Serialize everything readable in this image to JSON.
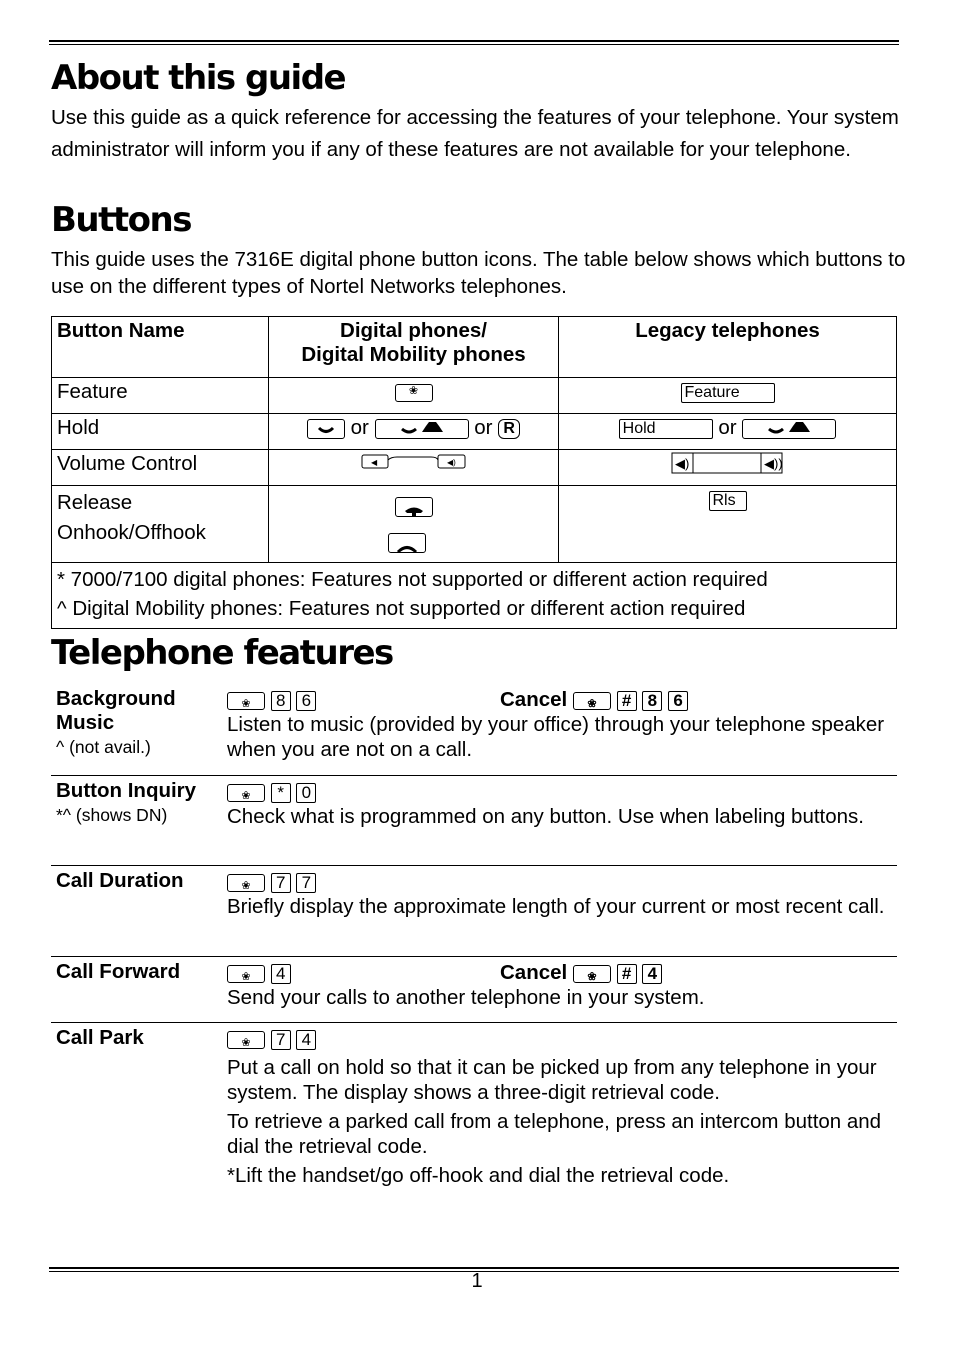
{
  "about": {
    "title": "About this guide",
    "body": "Use this guide as a quick reference for accessing the features of your telephone. Your system administrator will inform you if any of these features are not available for your telephone."
  },
  "buttons": {
    "title": "Buttons",
    "body": "This guide uses the 7316E digital phone button icons. The table below shows which buttons to use on the different types of Nortel Networks telephones.",
    "table": {
      "headers": [
        "Button Name",
        "Digital phones/",
        "Digital Mobility phones",
        "Legacy telephones"
      ],
      "rows": [
        {
          "name": "Feature",
          "digital": "feature-key-icon",
          "legacy": "Feature"
        },
        {
          "name": "Hold",
          "or": "or",
          "legacy": "Hold"
        },
        {
          "name": "Volume Control"
        },
        {
          "name": "Release",
          "name2": "Onhook/Offhook",
          "legacy": "Rls"
        }
      ],
      "r_key": "R",
      "notes": [
        "* 7000/7100 digital phones: Features not supported or different action required",
        "^ Digital Mobility phones: Features not supported or different action required"
      ]
    }
  },
  "features": {
    "title": "Telephone features",
    "cancel_label": "Cancel",
    "items": [
      {
        "name": "Background Music",
        "sub": "^ (not avail.)",
        "keys": [
          "8",
          "6"
        ],
        "cancel": [
          "#",
          "8",
          "6"
        ],
        "desc": [
          "Listen to music (provided by your office) through your telephone speaker when you are not on a call."
        ]
      },
      {
        "name": "Button Inquiry",
        "sub": "*^ (shows DN)",
        "keys": [
          "*",
          "0"
        ],
        "desc": [
          "Check what is programmed on any button. Use when labeling buttons."
        ]
      },
      {
        "name": "Call Duration",
        "keys": [
          "7",
          "7"
        ],
        "desc": [
          "Briefly display the approximate length of your current or most recent call."
        ]
      },
      {
        "name": "Call Forward",
        "keys": [
          "4"
        ],
        "cancel": [
          "#",
          "4"
        ],
        "desc": [
          "Send your calls to another telephone in your system."
        ]
      },
      {
        "name": "Call Park",
        "keys": [
          "7",
          "4"
        ],
        "desc": [
          "Put a call on hold so that it can be picked up from any telephone in your system. The display shows a three-digit retrieval code.",
          "To retrieve a parked call from a telephone, press an intercom button and dial the retrieval code.",
          "*Lift the handset/go off-hook and dial the retrieval code."
        ]
      }
    ]
  },
  "footer": {
    "page_number": "1"
  }
}
